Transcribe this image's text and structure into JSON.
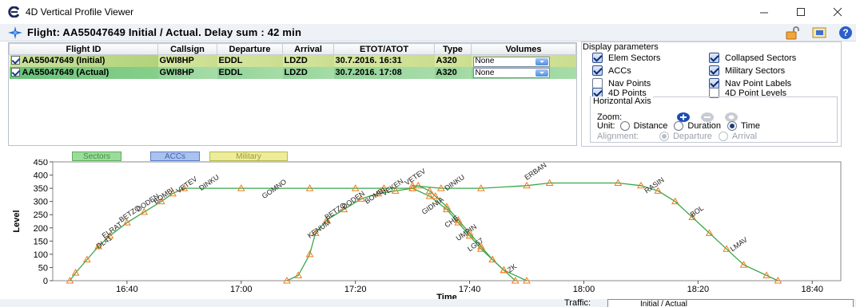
{
  "window": {
    "title": "4D Vertical Profile Viewer",
    "controls": [
      "minimize",
      "maximize",
      "close"
    ]
  },
  "flight_header": {
    "title": "Flight: AA55047649 Initial / Actual. Delay sum :  42 min",
    "icons": [
      "plane-icon",
      "unlock-icon",
      "export-icon",
      "help-icon"
    ]
  },
  "table": {
    "columns": [
      "Flight ID",
      "Callsign",
      "Departure",
      "Arrival",
      "ETOT/ATOT",
      "Type",
      "Volumes"
    ],
    "rows": [
      {
        "flight_id": "AA55047649 (Initial)",
        "callsign": "GWI8HP",
        "departure": "EDDL",
        "arrival": "LDZD",
        "etot": "30.7.2016. 16:31",
        "type": "A320",
        "volumes": "None",
        "checked": true
      },
      {
        "flight_id": "AA55047649 (Actual)",
        "callsign": "GWI8HP",
        "departure": "EDDL",
        "arrival": "LDZD",
        "etot": "30.7.2016. 17:08",
        "type": "A320",
        "volumes": "None",
        "checked": true
      }
    ]
  },
  "display_params": {
    "title": "Display parameters",
    "options": [
      {
        "label": "Elem Sectors",
        "checked": true
      },
      {
        "label": "Collapsed Sectors",
        "checked": true
      },
      {
        "label": "ACCs",
        "checked": true
      },
      {
        "label": "Military Sectors",
        "checked": true
      },
      {
        "label": "Nav Points",
        "checked": false
      },
      {
        "label": "Nav Point Labels",
        "checked": true
      },
      {
        "label": "4D Points",
        "checked": true
      },
      {
        "label": "4D Point Levels",
        "checked": false
      }
    ],
    "horizontal_axis": {
      "title": "Horizontal Axis",
      "zoom_label": "Zoom:",
      "unit_label": "Unit:",
      "units": [
        {
          "label": "Distance",
          "selected": false
        },
        {
          "label": "Duration",
          "selected": false
        },
        {
          "label": "Time",
          "selected": true
        }
      ],
      "alignment_label": "Alignment:",
      "alignments": [
        {
          "label": "Departure",
          "selected": true
        },
        {
          "label": "Arrival",
          "selected": false
        }
      ]
    }
  },
  "legend": [
    {
      "label": "Sectors",
      "color": "#9bdc9b",
      "border": "#5fae5f"
    },
    {
      "label": "ACCs",
      "color": "#a9c2ef",
      "border": "#5b7fc9"
    },
    {
      "label": "Military",
      "color": "#ecec9a",
      "border": "#b9b94e"
    }
  ],
  "chart_data": {
    "type": "line",
    "xlabel": "Time",
    "ylabel": "Level",
    "x_ticks": [
      "16:40",
      "17:00",
      "17:20",
      "17:40",
      "18:00",
      "18:20",
      "18:40"
    ],
    "y_ticks": [
      0,
      50,
      100,
      150,
      200,
      250,
      300,
      350,
      400,
      450
    ],
    "ylim": [
      0,
      450
    ],
    "series": [
      {
        "color": "#3aa84a",
        "marker_color": "#f07a1c",
        "points": [
          [
            "16:30",
            0
          ],
          [
            "16:31",
            30
          ],
          [
            "16:33",
            80
          ],
          [
            "16:35",
            130
          ],
          [
            "16:37",
            170
          ],
          [
            "16:40",
            220
          ],
          [
            "16:43",
            260
          ],
          [
            "16:46",
            300
          ],
          [
            "16:48",
            330
          ],
          [
            "16:50",
            350
          ],
          [
            "17:00",
            350
          ],
          [
            "17:12",
            350
          ],
          [
            "17:20",
            350
          ],
          [
            "17:25",
            350
          ],
          [
            "17:30",
            350
          ],
          [
            "17:33",
            320
          ],
          [
            "17:36",
            270
          ],
          [
            "17:38",
            220
          ],
          [
            "17:40",
            170
          ],
          [
            "17:42",
            120
          ],
          [
            "17:44",
            80
          ],
          [
            "17:46",
            40
          ],
          [
            "17:48",
            0
          ]
        ],
        "labels": [
          {
            "text": "DL41",
            "x": "16:35",
            "y": 120
          },
          {
            "text": "ELRAT",
            "x": "16:36",
            "y": 160
          },
          {
            "text": "BETZO",
            "x": "16:39",
            "y": 220
          },
          {
            "text": "DODEN",
            "x": "16:42",
            "y": 260
          },
          {
            "text": "BOMBI",
            "x": "16:45",
            "y": 290
          },
          {
            "text": "VETEV",
            "x": "16:49",
            "y": 330
          },
          {
            "text": "DINKU",
            "x": "16:53",
            "y": 340
          },
          {
            "text": "GOMNO",
            "x": "17:04",
            "y": 310
          }
        ]
      },
      {
        "color": "#3aa84a",
        "marker_color": "#f07a1c",
        "points": [
          [
            "17:08",
            0
          ],
          [
            "17:10",
            20
          ],
          [
            "17:12",
            100
          ],
          [
            "17:13",
            180
          ],
          [
            "17:15",
            230
          ],
          [
            "17:18",
            270
          ],
          [
            "17:21",
            310
          ],
          [
            "17:24",
            330
          ],
          [
            "17:27",
            340
          ],
          [
            "17:30",
            350
          ],
          [
            "17:31",
            360
          ],
          [
            "17:33",
            340
          ],
          [
            "17:34",
            320
          ],
          [
            "17:36",
            280
          ],
          [
            "17:38",
            230
          ],
          [
            "17:40",
            180
          ],
          [
            "17:42",
            130
          ],
          [
            "17:44",
            80
          ],
          [
            "17:46",
            40
          ],
          [
            "17:50",
            0
          ]
        ],
        "labels": [
          {
            "text": "KENUM",
            "x": "17:12",
            "y": 160
          },
          {
            "text": "BETZO",
            "x": "17:15",
            "y": 230
          },
          {
            "text": "DODEN",
            "x": "17:18",
            "y": 270
          },
          {
            "text": "BOMBI",
            "x": "17:22",
            "y": 290
          },
          {
            "text": "VEKEN",
            "x": "17:25",
            "y": 320
          },
          {
            "text": "VETEV",
            "x": "17:29",
            "y": 360
          },
          {
            "text": "GIDNIA",
            "x": "17:32",
            "y": 250
          },
          {
            "text": "CHE",
            "x": "17:36",
            "y": 200
          },
          {
            "text": "UMPIN",
            "x": "17:38",
            "y": 150
          },
          {
            "text": "LG57",
            "x": "17:40",
            "y": 110
          },
          {
            "text": "ZK",
            "x": "17:47",
            "y": 30
          }
        ]
      },
      {
        "color": "#3aa84a",
        "marker_color": "#f07a1c",
        "points": [
          [
            "17:30",
            360
          ],
          [
            "17:35",
            350
          ],
          [
            "17:42",
            350
          ],
          [
            "17:50",
            360
          ],
          [
            "17:54",
            370
          ],
          [
            "18:06",
            370
          ],
          [
            "18:10",
            360
          ],
          [
            "18:13",
            340
          ],
          [
            "18:16",
            300
          ],
          [
            "18:19",
            240
          ],
          [
            "18:22",
            180
          ],
          [
            "18:25",
            120
          ],
          [
            "18:28",
            60
          ],
          [
            "18:32",
            20
          ],
          [
            "18:34",
            0
          ]
        ],
        "labels": [
          {
            "text": "DINKU",
            "x": "17:36",
            "y": 340
          },
          {
            "text": "ERBAN",
            "x": "17:50",
            "y": 380
          },
          {
            "text": "RASIN",
            "x": "18:11",
            "y": 330
          },
          {
            "text": "BOL",
            "x": "18:19",
            "y": 240
          },
          {
            "text": "LMAV",
            "x": "18:26",
            "y": 110
          }
        ]
      }
    ]
  },
  "status": {
    "traffic_label": "Traffic:",
    "traffic_value": "Initial / Actual"
  }
}
